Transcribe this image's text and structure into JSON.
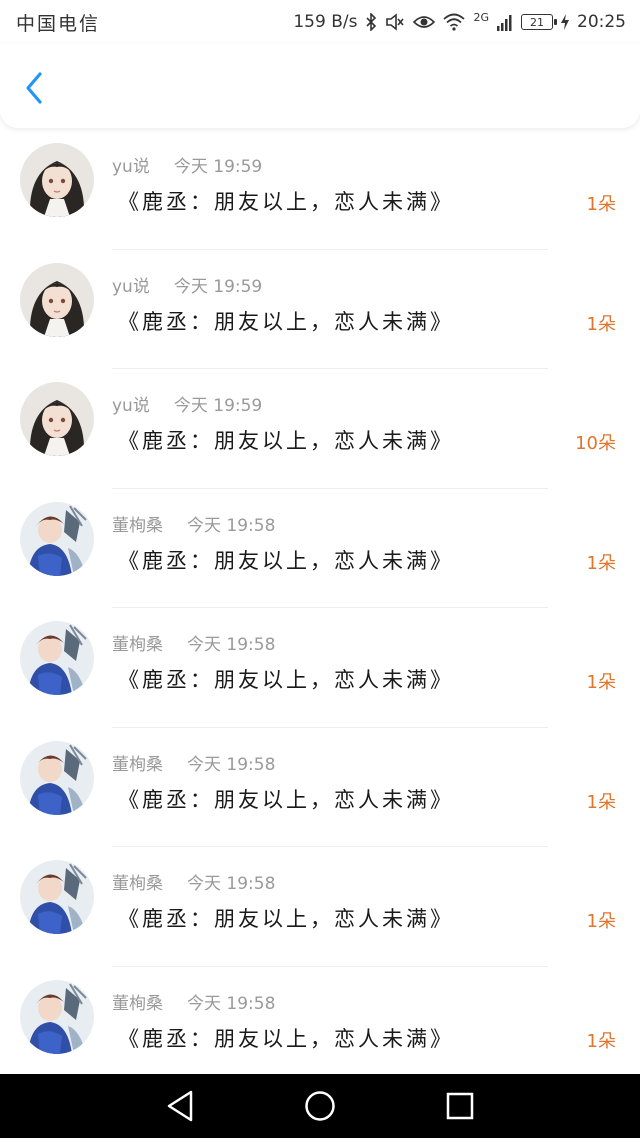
{
  "status_bar": {
    "carrier": "中国电信",
    "speed": "159 B/s",
    "network": "2G",
    "battery": "21",
    "time": "20:25"
  },
  "header": {
    "back_icon": "chevron-left-icon",
    "accent_color": "#2196F3"
  },
  "items": [
    {
      "user": "yu说",
      "time": "今天 19:59",
      "title": "《鹿丞：朋友以上，恋人未满》",
      "count": "1朵",
      "avatar": "girl"
    },
    {
      "user": "yu说",
      "time": "今天 19:59",
      "title": "《鹿丞：朋友以上，恋人未满》",
      "count": "1朵",
      "avatar": "girl"
    },
    {
      "user": "yu说",
      "time": "今天 19:59",
      "title": "《鹿丞：朋友以上，恋人未满》",
      "count": "10朵",
      "avatar": "girl"
    },
    {
      "user": "董栒桑",
      "time": "今天 19:58",
      "title": "《鹿丞：朋友以上，恋人未满》",
      "count": "1朵",
      "avatar": "boy"
    },
    {
      "user": "董栒桑",
      "time": "今天 19:58",
      "title": "《鹿丞：朋友以上，恋人未满》",
      "count": "1朵",
      "avatar": "boy"
    },
    {
      "user": "董栒桑",
      "time": "今天 19:58",
      "title": "《鹿丞：朋友以上，恋人未满》",
      "count": "1朵",
      "avatar": "boy"
    },
    {
      "user": "董栒桑",
      "time": "今天 19:58",
      "title": "《鹿丞：朋友以上，恋人未满》",
      "count": "1朵",
      "avatar": "boy"
    },
    {
      "user": "董栒桑",
      "time": "今天 19:58",
      "title": "《鹿丞：朋友以上，恋人未满》",
      "count": "1朵",
      "avatar": "boy"
    }
  ],
  "nav_bar": {
    "back": "back-triangle-icon",
    "home": "home-circle-icon",
    "recents": "recents-square-icon"
  }
}
